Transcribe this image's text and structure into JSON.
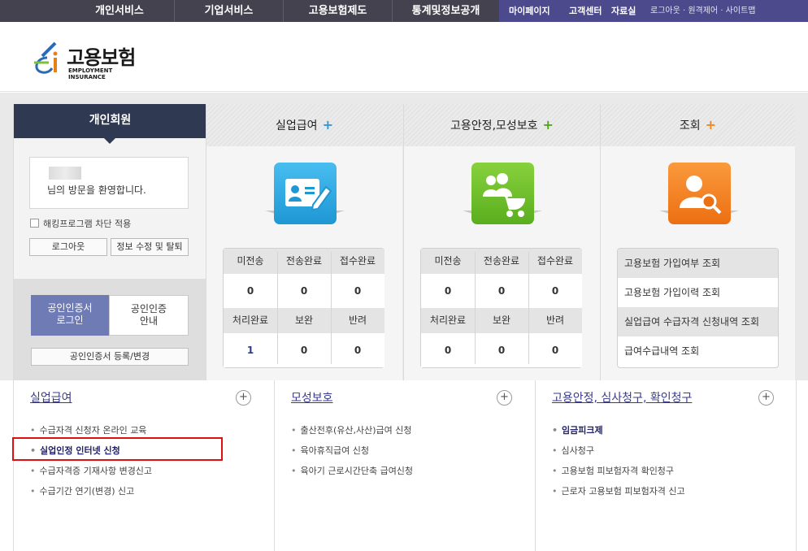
{
  "topnav": {
    "items": [
      "개인서비스",
      "기업서비스",
      "고용보험제도",
      "통계및정보공개"
    ],
    "right_items": [
      "마이페이지",
      "고객센터",
      "자료실"
    ],
    "util": "로그아웃 · 원격제어 · 사이트맵"
  },
  "logo": {
    "ko": "고용보험",
    "en": "EMPLOYMENT INSURANCE"
  },
  "member": {
    "title": "개인회원",
    "welcome": "님의 방문을 환영합니다.",
    "hack_block": "해킹프로그램 차단 적용",
    "logout": "로그아웃",
    "edit": "정보 수정 및 탈퇴",
    "cert_login": [
      "공인인증서",
      "로그인"
    ],
    "cert_guide": [
      "공인인증",
      "안내"
    ],
    "cert_register": "공인인증서 등록/변경"
  },
  "services": [
    {
      "title": "실업급여",
      "plus": "+",
      "icon": "id-card-pen-icon",
      "stats": {
        "head1": [
          "미전송",
          "전송완료",
          "접수완료"
        ],
        "vals1": [
          "0",
          "0",
          "0"
        ],
        "head2": [
          "처리완료",
          "보완",
          "반려"
        ],
        "vals2": [
          "1",
          "0",
          "0"
        ]
      }
    },
    {
      "title": "고용안정,모성보호",
      "plus": "+",
      "icon": "family-stroller-icon",
      "stats": {
        "head1": [
          "미전송",
          "전송완료",
          "접수완료"
        ],
        "vals1": [
          "0",
          "0",
          "0"
        ],
        "head2": [
          "처리완료",
          "보완",
          "반려"
        ],
        "vals2": [
          "0",
          "0",
          "0"
        ]
      }
    },
    {
      "title": "조회",
      "plus": "+",
      "icon": "user-search-icon",
      "inquiries": [
        "고용보험 가입여부 조회",
        "고용보험 가입이력 조회",
        "실업급여 수급자격 신청내역 조회",
        "급여수급내역 조회"
      ]
    }
  ],
  "bottom": [
    {
      "title": "실업급여",
      "plus": "+",
      "links": [
        "수급자격 신청자 온라인 교육",
        "실업인정 인터넷 신청",
        "수급자격증 기재사항 변경신고",
        "수급기간 연기(변경) 신고"
      ]
    },
    {
      "title": "모성보호",
      "plus": "+",
      "links": [
        "출산전후(유산,사산)급여 신청",
        "육아휴직급여 신청",
        "육아기 근로시간단축 급여신청"
      ]
    },
    {
      "title": "고용안정, 심사청구, 확인청구",
      "plus": "+",
      "links": [
        "임금피크제",
        "심사청구",
        "고용보험 피보험자격 확인청구",
        "근로자 고용보험 피보험자격 신고"
      ]
    }
  ],
  "colors": {
    "topnav": "#45424f",
    "topnav_right": "#4c4a8c",
    "icon_blue": "#2ea9e0",
    "icon_green": "#6cbf2b",
    "icon_orange": "#f47b20",
    "plus_blue": "#2f9bd8",
    "plus_green": "#55a61f",
    "plus_orange": "#f08a1e",
    "highlight": "#e01010"
  }
}
